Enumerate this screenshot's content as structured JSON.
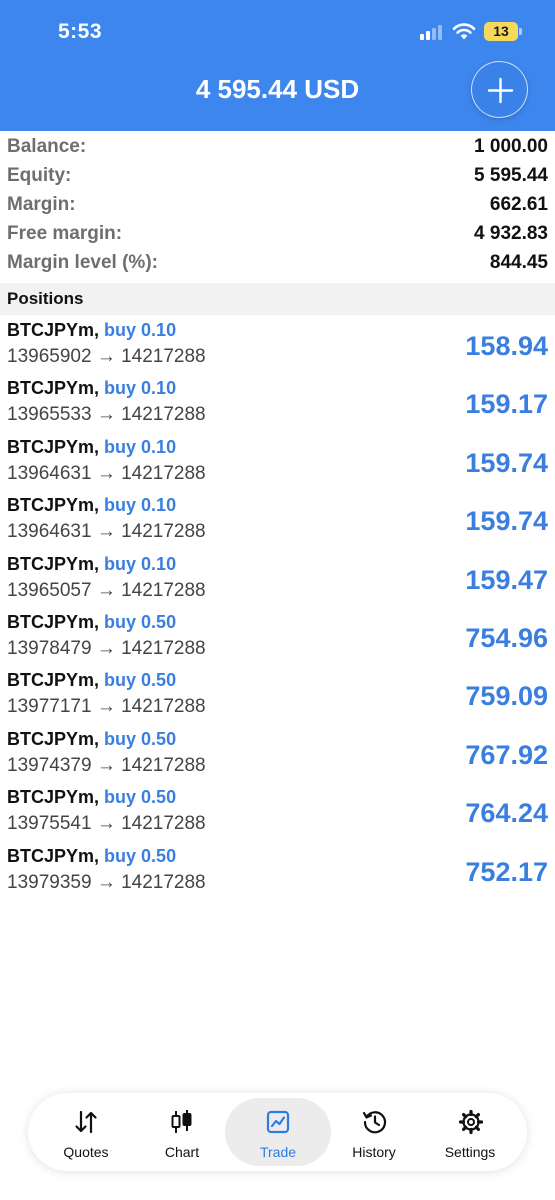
{
  "status_bar": {
    "time": "5:53",
    "battery": "13"
  },
  "header": {
    "title": "4 595.44 USD"
  },
  "account": [
    {
      "label": "Balance:",
      "value": "1 000.00"
    },
    {
      "label": "Equity:",
      "value": "5 595.44"
    },
    {
      "label": "Margin:",
      "value": "662.61"
    },
    {
      "label": "Free margin:",
      "value": "4 932.83"
    },
    {
      "label": "Margin level (%):",
      "value": "844.45"
    }
  ],
  "positions_header": "Positions",
  "positions": [
    {
      "symbol": "BTCJPYm,",
      "side": "buy 0.10",
      "prices": "13965902 → 14217288",
      "profit": "158.94"
    },
    {
      "symbol": "BTCJPYm,",
      "side": "buy 0.10",
      "prices": "13965533 → 14217288",
      "profit": "159.17"
    },
    {
      "symbol": "BTCJPYm,",
      "side": "buy 0.10",
      "prices": "13964631 → 14217288",
      "profit": "159.74"
    },
    {
      "symbol": "BTCJPYm,",
      "side": "buy 0.10",
      "prices": "13964631 → 14217288",
      "profit": "159.74"
    },
    {
      "symbol": "BTCJPYm,",
      "side": "buy 0.10",
      "prices": "13965057 → 14217288",
      "profit": "159.47"
    },
    {
      "symbol": "BTCJPYm,",
      "side": "buy 0.50",
      "prices": "13978479 → 14217288",
      "profit": "754.96"
    },
    {
      "symbol": "BTCJPYm,",
      "side": "buy 0.50",
      "prices": "13977171 → 14217288",
      "profit": "759.09"
    },
    {
      "symbol": "BTCJPYm,",
      "side": "buy 0.50",
      "prices": "13974379 → 14217288",
      "profit": "767.92"
    },
    {
      "symbol": "BTCJPYm,",
      "side": "buy 0.50",
      "prices": "13975541 → 14217288",
      "profit": "764.24"
    },
    {
      "symbol": "BTCJPYm,",
      "side": "buy 0.50",
      "prices": "13979359 → 14217288",
      "profit": "752.17"
    }
  ],
  "tabs": [
    {
      "label": "Quotes",
      "icon": "quotes-icon",
      "active": false
    },
    {
      "label": "Chart",
      "icon": "chart-icon",
      "active": false
    },
    {
      "label": "Trade",
      "icon": "trade-icon",
      "active": true
    },
    {
      "label": "History",
      "icon": "history-icon",
      "active": false
    },
    {
      "label": "Settings",
      "icon": "settings-icon",
      "active": false
    }
  ],
  "colors": {
    "header": "#3d86ee",
    "accent": "#3a7fe0"
  }
}
